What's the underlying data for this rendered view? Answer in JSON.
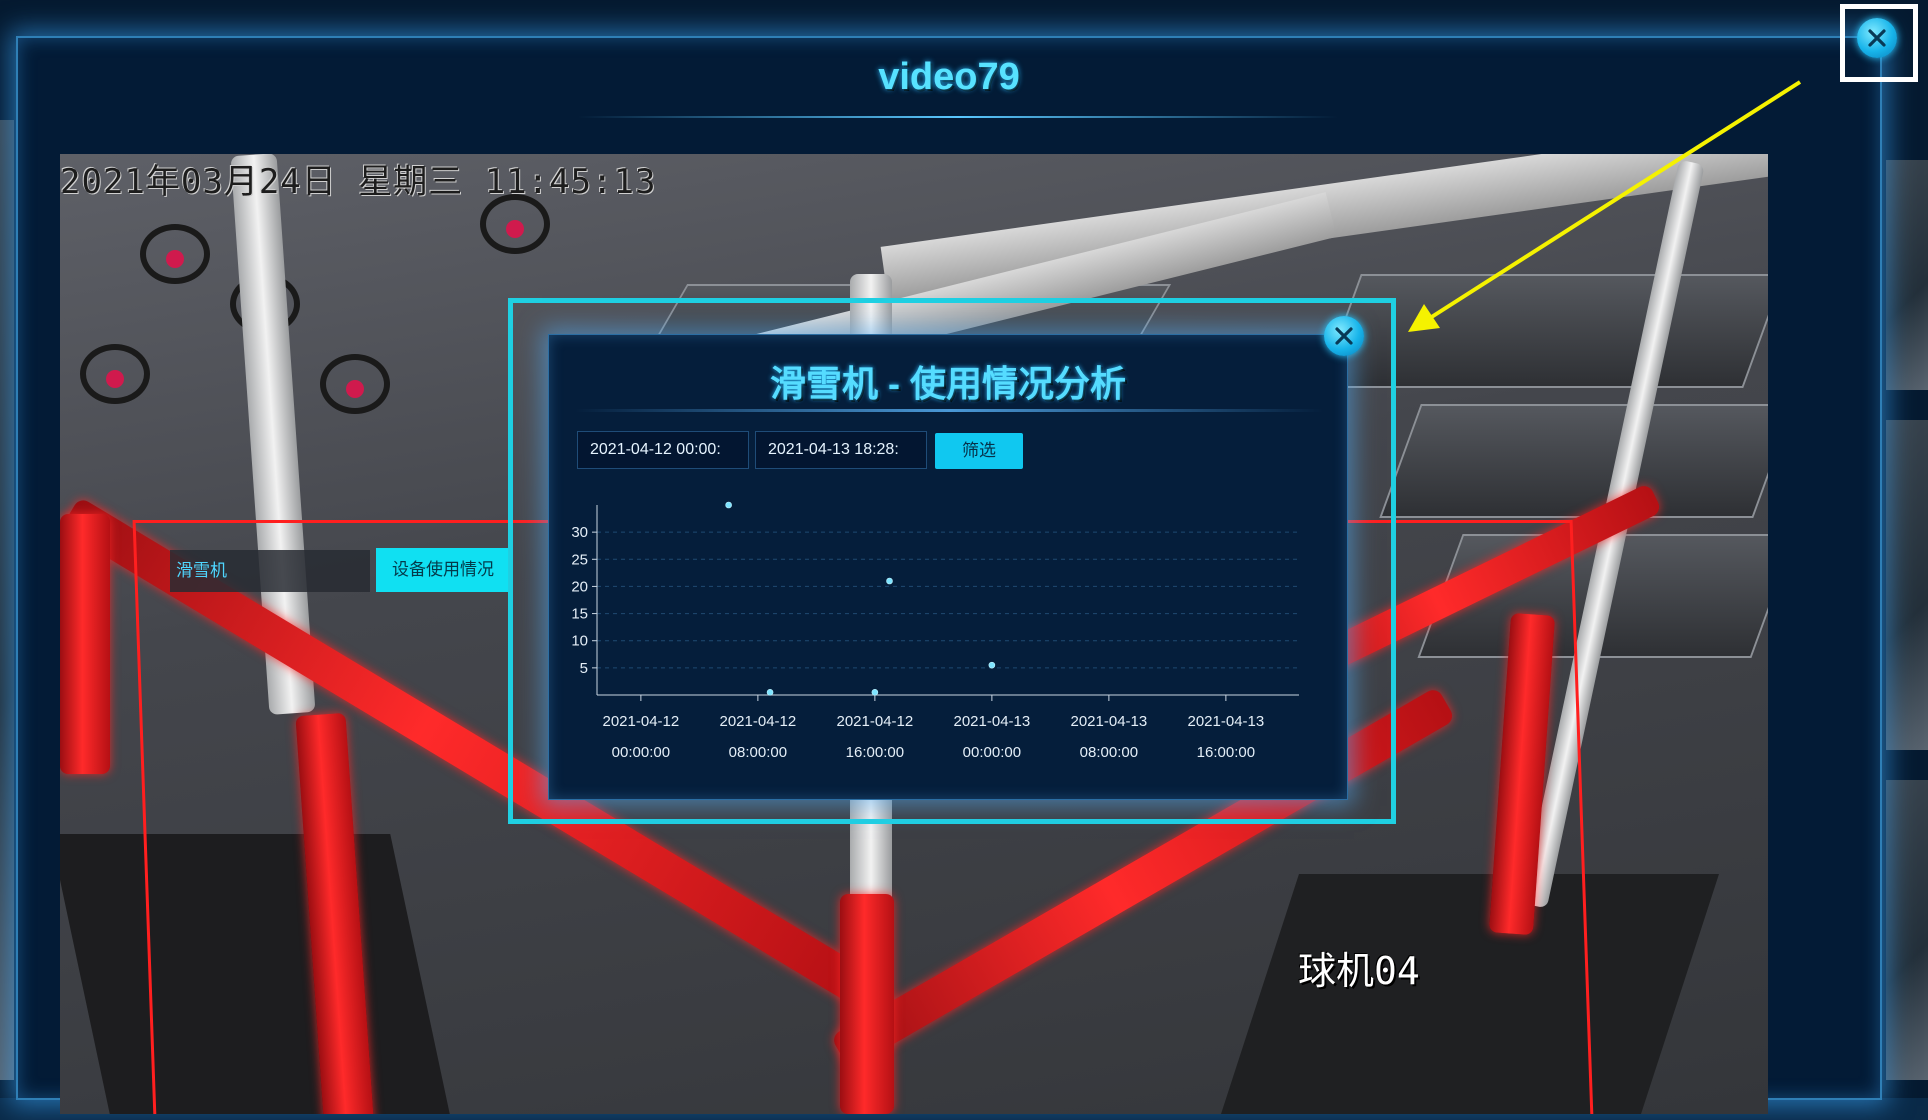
{
  "modal": {
    "title": "video79"
  },
  "video": {
    "timestamp": "2021年03月24日 星期三 11:45:13",
    "camera_name": "球机04",
    "device_label": "滑雪机",
    "device_usage_button": "设备使用情况"
  },
  "popup": {
    "title": "滑雪机 - 使用情况分析",
    "start_date": "2021-04-12 00:00:",
    "end_date": "2021-04-13 18:28:",
    "filter_button": "筛选"
  },
  "icons": {
    "close": "close-icon",
    "arrow": "arrow-annotation"
  },
  "colors": {
    "accent": "#10c8f0",
    "title": "#55dcff",
    "roi": "#ff1f1f",
    "highlight": "#1fd0e2",
    "arrow": "#f5f200"
  },
  "chart_data": {
    "type": "scatter",
    "x_type": "time",
    "x_range": [
      "2021-04-11 21:00:00",
      "2021-04-13 21:00:00"
    ],
    "x_ticks": [
      "2021-04-12 00:00:00",
      "2021-04-12 08:00:00",
      "2021-04-12 16:00:00",
      "2021-04-13 00:00:00",
      "2021-04-13 08:00:00",
      "2021-04-13 16:00:00"
    ],
    "ylim": [
      0,
      35
    ],
    "y_ticks": [
      5,
      10,
      15,
      20,
      25,
      30
    ],
    "grid": "horizontal-dashed",
    "points": [
      {
        "x": "2021-04-12 06:00:00",
        "y": 35
      },
      {
        "x": "2021-04-12 08:50:00",
        "y": 0.5
      },
      {
        "x": "2021-04-12 16:00:00",
        "y": 0.5
      },
      {
        "x": "2021-04-12 17:00:00",
        "y": 21
      },
      {
        "x": "2021-04-13 00:00:00",
        "y": 5.5
      }
    ]
  }
}
